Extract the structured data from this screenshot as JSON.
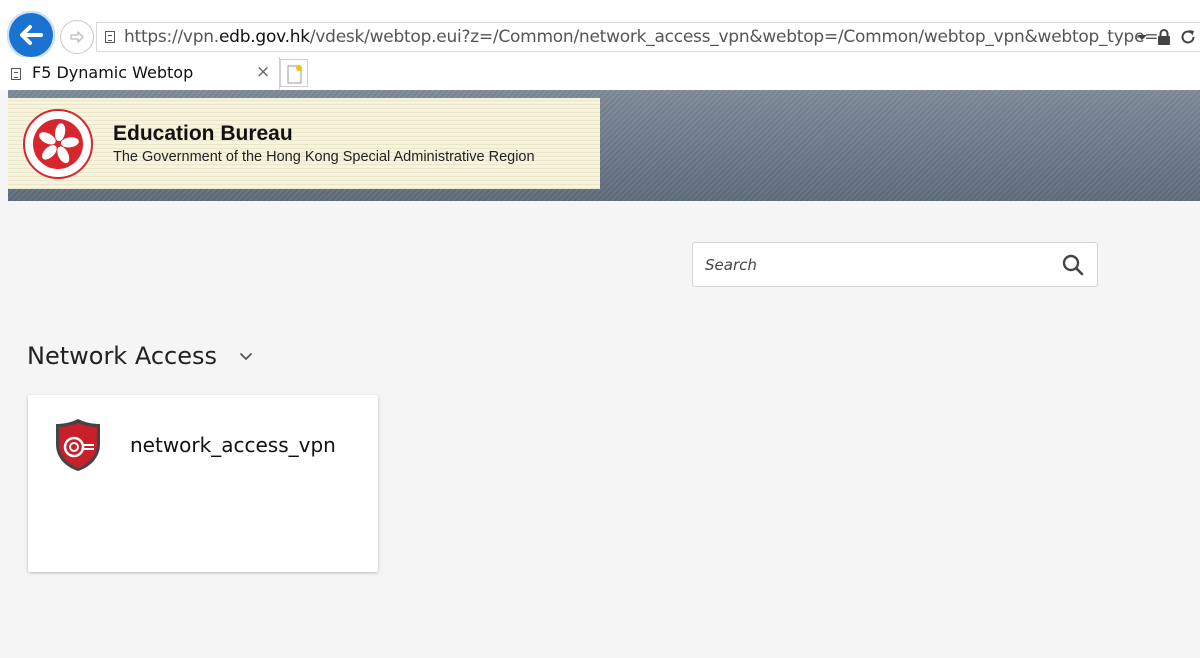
{
  "browser": {
    "url": {
      "prefix": "https://vpn.",
      "host": "edb.gov.hk",
      "path": "/vdesk/webtop.eui?z=/Common/network_access_vpn&webtop=/Common/webtop_vpn&webtop_type="
    },
    "tab": {
      "title": "F5 Dynamic Webtop",
      "close_label": "×"
    }
  },
  "header": {
    "org_name": "Education Bureau",
    "org_subtitle": "The Government of the Hong Kong Special Administrative Region"
  },
  "search": {
    "placeholder": "Search",
    "value": ""
  },
  "section": {
    "title": "Network Access",
    "items": [
      {
        "label": "network_access_vpn",
        "icon": "network-access-shield-icon"
      }
    ]
  },
  "colors": {
    "accent_blue": "#1a73d1",
    "header_band": "#6b7888",
    "logo_panel": "#f6f4dc",
    "emblem_red": "#d7262d",
    "shield_red": "#c8202a"
  }
}
